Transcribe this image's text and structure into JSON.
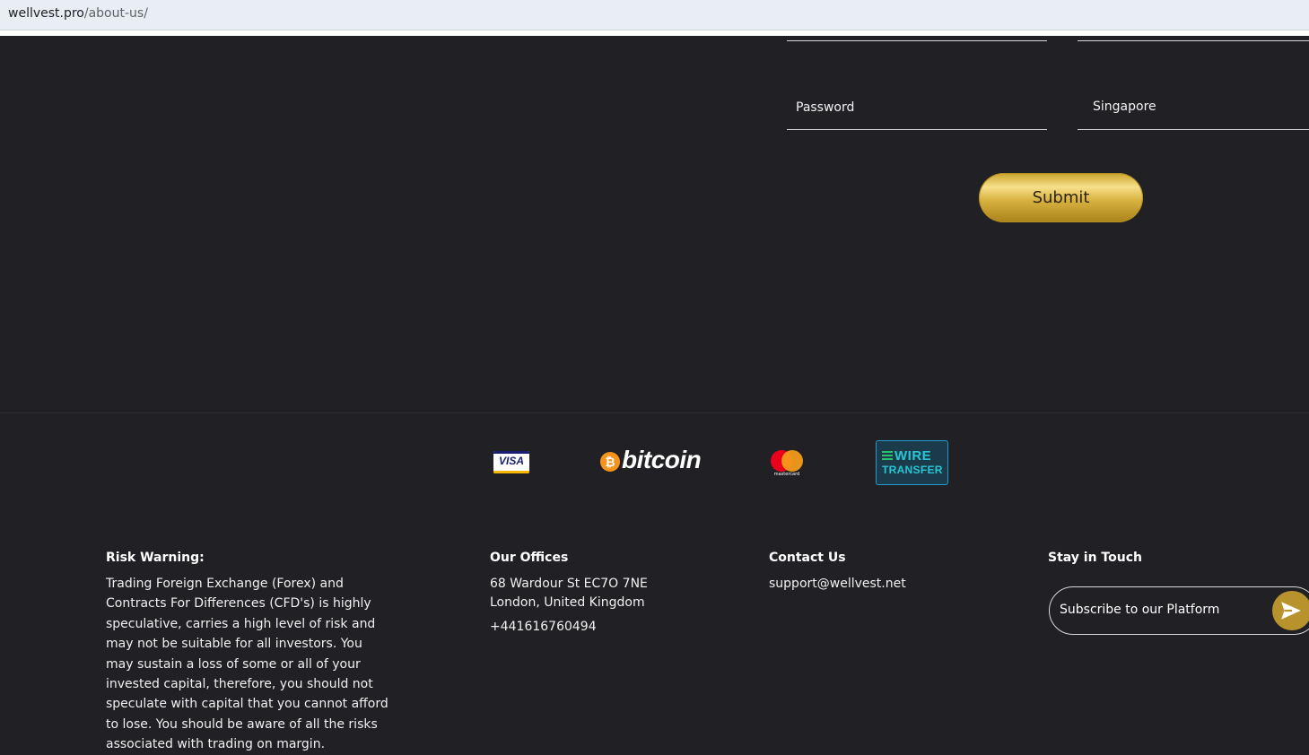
{
  "browser": {
    "url_host": "wellvest.pro",
    "url_path": "/about-us/"
  },
  "form": {
    "password_placeholder": "Password",
    "country_value": "Singapore",
    "submit_label": "Submit"
  },
  "payments": {
    "visa_label": "VISA",
    "bitcoin_symbol": "₿",
    "bitcoin_label": "bitcoin",
    "mastercard_label": "mastercard",
    "wire_line1": "WIRE",
    "wire_line2": "TRANSFER"
  },
  "footer": {
    "risk_title": "Risk Warning:",
    "risk_text": "Trading Foreign Exchange (Forex) and Contracts For Differences (CFD's) is highly speculative, carries a high level of risk and may not be suitable for all investors. You may sustain a loss of some or all of your invested capital, therefore, you should not speculate with capital that you cannot afford to lose. You should be aware of all the risks associated with trading on margin.",
    "offices_title": "Our Offices",
    "address_line1": "68 Wardour St EC7O 7NE",
    "address_line2": "London, United Kingdom",
    "phone": "+441616760494",
    "contact_title": "Contact Us",
    "email": "support@wellvest.net",
    "stay_title": "Stay in Touch",
    "subscribe_placeholder": "Subscribe to our Platform"
  },
  "colors": {
    "background": "#212125",
    "gold": "#d4af37",
    "send_button": "#b8922c"
  }
}
